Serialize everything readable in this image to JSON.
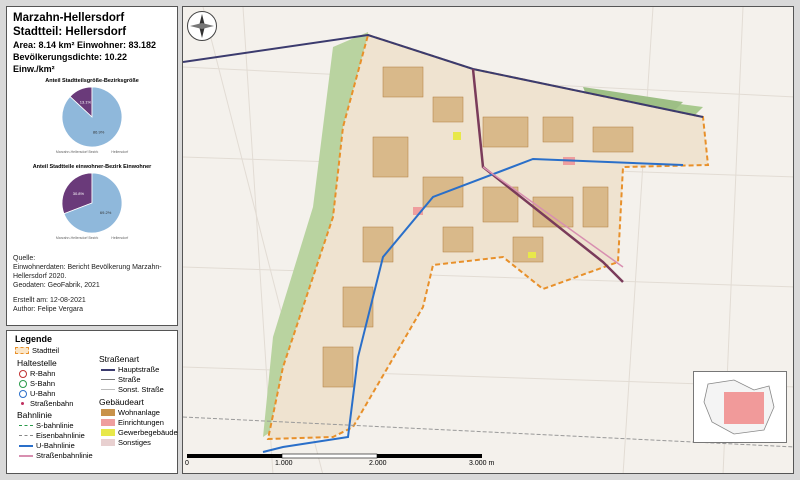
{
  "info": {
    "district": "Marzahn-Hellersdorf",
    "stadtteil": "Stadtteil: Hellersdorf",
    "stats": "Area: 8.14 km²  Einwohner: 83.182",
    "density": "Bevölkerungsdichte: 10.22 Einw./km²",
    "source_label": "Quelle:",
    "source_1": "Einwohnerdaten: Bericht Bevölkerung Marzahn-Hellersdorf 2020.",
    "source_2": "Geodaten: GeoFabrik, 2021",
    "created": "Erstellt am: 12-08-2021",
    "author": "Author: Felipe Vergara"
  },
  "chart_data": [
    {
      "type": "pie",
      "title": "Anteil Stadtteilsgröße-Bezirksgröße",
      "labels": [
        "Marzahn-Hellersdorf Bezirk",
        "Hellersdorf"
      ],
      "values": [
        86.9,
        13.1
      ],
      "value_labels": [
        "86.9%",
        "13.1%"
      ],
      "colors": [
        "#8fb8db",
        "#6a3a7a"
      ]
    },
    {
      "type": "pie",
      "title": "Anteil Stadtteile einwohner-Bezirk Einwohner",
      "labels": [
        "Marzahn-Hellersdorf Bezirk",
        "Hellersdorf"
      ],
      "values": [
        69.2,
        30.8
      ],
      "value_labels": [
        "69.2%",
        "30.8%"
      ],
      "colors": [
        "#8fb8db",
        "#6a3a7a"
      ]
    }
  ],
  "legend": {
    "title": "Legende",
    "stadtteil": "Stadtteil",
    "haltestelle": "Haltestelle",
    "r_bahn": "R-Bahn",
    "s_bahn": "S-Bahn",
    "u_bahn": "U-Bahn",
    "strassenbahn": "Straßenbahn",
    "bahnlinie": "Bahnlinie",
    "s_bahnlinie": "S-bahnlinie",
    "eisenbahnlinie": "Eisenbahnlinie",
    "u_bahnlinie": "U-Bahnlinie",
    "strassenbahnlinie": "Straßenbahnlinie",
    "strassenart": "Straßenart",
    "hauptstrasse": "Hauptstraße",
    "strasse": "Straße",
    "sonst_strasse": "Sonst. Straße",
    "gebaeudeart": "Gebäudeart",
    "wohnanlage": "Wohnanlage",
    "einrichtungen": "Einrichtungen",
    "gewerbegebaeude": "Gewerbegebäude",
    "sonstiges": "Sonstiges",
    "colors": {
      "stadtteil": "#e8902a",
      "wohnanlage": "#c8924a",
      "einrichtungen": "#ef9e9e",
      "gewerbegebaeude": "#e8e84a",
      "sonstiges": "#e8d0d0",
      "u_bahn": "#2a6fc9",
      "hauptstrasse": "#3b3b6e"
    }
  },
  "scale": {
    "l0": "0",
    "l1": "1.000",
    "l2": "2.000",
    "l3": "3.000 m"
  },
  "icons": {
    "compass": "compass-icon"
  }
}
